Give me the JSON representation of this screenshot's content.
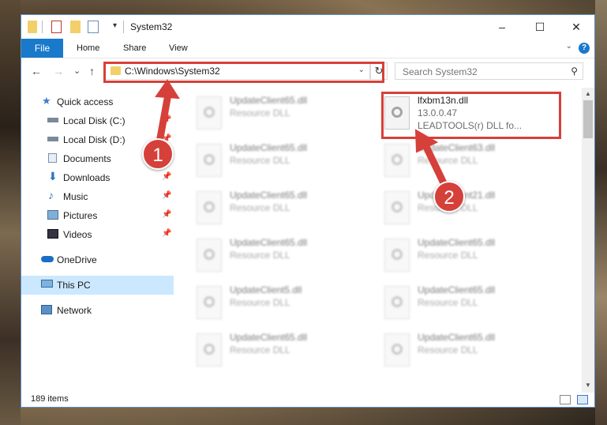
{
  "window": {
    "title": "System32",
    "minimize": "–",
    "maximize": "☐",
    "close": "✕"
  },
  "ribbon": {
    "file": "File",
    "home": "Home",
    "share": "Share",
    "view": "View",
    "help": "?"
  },
  "nav": {
    "back": "←",
    "forward": "→",
    "recent": "⌄",
    "up": "↑",
    "address": "C:\\Windows\\System32",
    "refresh": "↻",
    "search_placeholder": "Search System32",
    "search_icon": "⚲"
  },
  "sidebar": {
    "items": [
      {
        "label": "Quick access",
        "icon": "star-icon"
      },
      {
        "label": "Local Disk (C:)",
        "icon": "drive-icon"
      },
      {
        "label": "Local Disk (D:)",
        "icon": "drive-icon"
      },
      {
        "label": "Documents",
        "icon": "documents-icon"
      },
      {
        "label": "Downloads",
        "icon": "downloads-icon"
      },
      {
        "label": "Music",
        "icon": "music-icon"
      },
      {
        "label": "Pictures",
        "icon": "pictures-icon"
      },
      {
        "label": "Videos",
        "icon": "videos-icon"
      },
      {
        "label": "OneDrive",
        "icon": "cloud-icon"
      },
      {
        "label": "This PC",
        "icon": "pc-icon"
      },
      {
        "label": "Network",
        "icon": "network-icon"
      }
    ],
    "pin": "📌"
  },
  "files": {
    "highlighted": {
      "name": "lfxbm13n.dll",
      "version": "13.0.0.47",
      "description": "LEADTOOLS(r) DLL fo..."
    },
    "left": [
      {
        "name": "UpdateClient65.dll",
        "type": "Resource DLL"
      },
      {
        "name": "UpdateClient65.dll",
        "type": "Resource DLL"
      },
      {
        "name": "UpdateClient65.dll",
        "type": "Resource DLL"
      },
      {
        "name": "UpdateClient65.dll",
        "type": "Resource DLL"
      },
      {
        "name": "UpdateClient5.dll",
        "type": "Resource DLL"
      },
      {
        "name": "UpdateClient65.dll",
        "type": "Resource DLL"
      }
    ],
    "right": [
      {
        "name": "UpdateClient63.dll",
        "type": "Resource DLL"
      },
      {
        "name": "UpdateClient21.dll",
        "type": "Resource DLL"
      },
      {
        "name": "UpdateClient65.dll",
        "type": "Resource DLL"
      },
      {
        "name": "UpdateClient65.dll",
        "type": "Resource DLL"
      },
      {
        "name": "UpdateClient65.dll",
        "type": "Resource DLL"
      }
    ]
  },
  "status": {
    "count": "189 items"
  },
  "annotations": {
    "one": "1",
    "two": "2",
    "color": "#d6403a"
  }
}
